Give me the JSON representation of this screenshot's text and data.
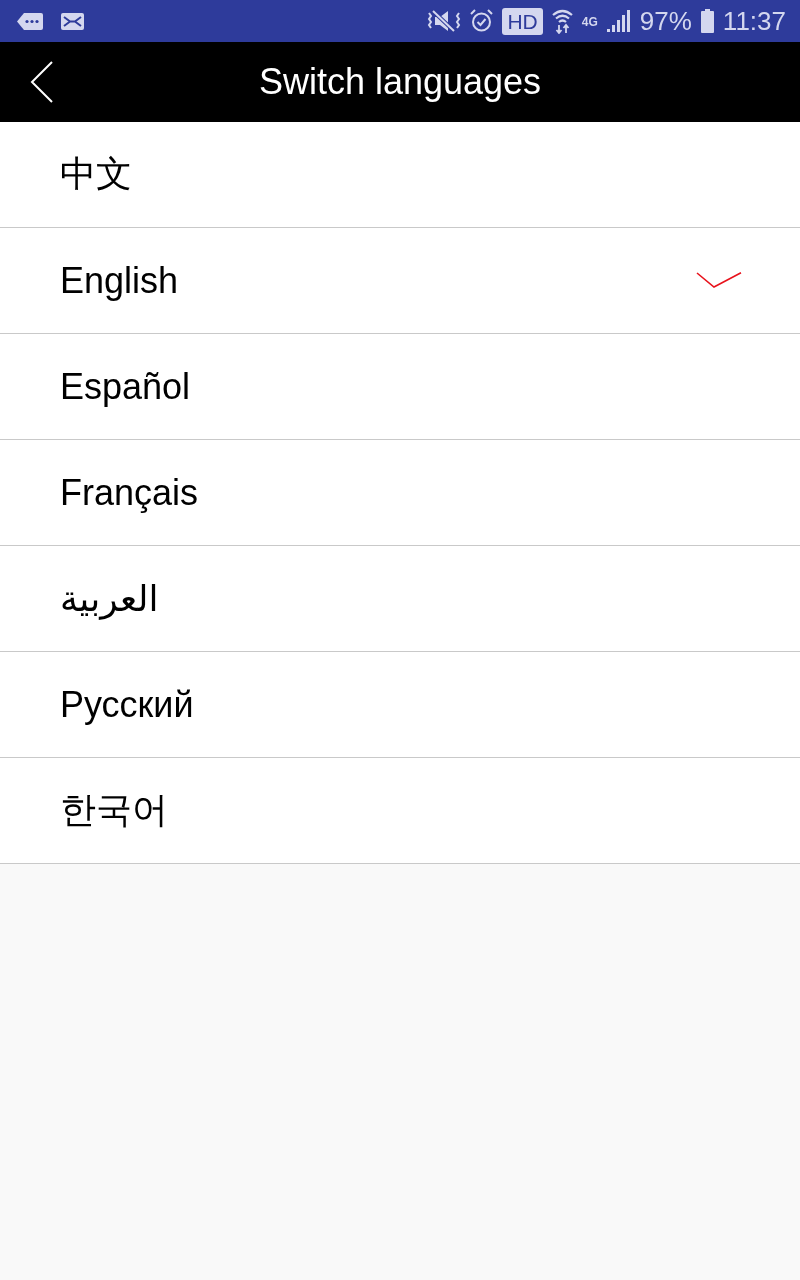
{
  "status_bar": {
    "network_badge": "HD",
    "network_type": "4G",
    "battery": "97%",
    "time": "11:37"
  },
  "header": {
    "title": "Switch languages"
  },
  "languages": [
    {
      "label": "中文",
      "selected": false
    },
    {
      "label": "English",
      "selected": true
    },
    {
      "label": "Español",
      "selected": false
    },
    {
      "label": "Français",
      "selected": false
    },
    {
      "label": "العربية",
      "selected": false
    },
    {
      "label": "Русский",
      "selected": false
    },
    {
      "label": "한국어",
      "selected": false
    }
  ]
}
